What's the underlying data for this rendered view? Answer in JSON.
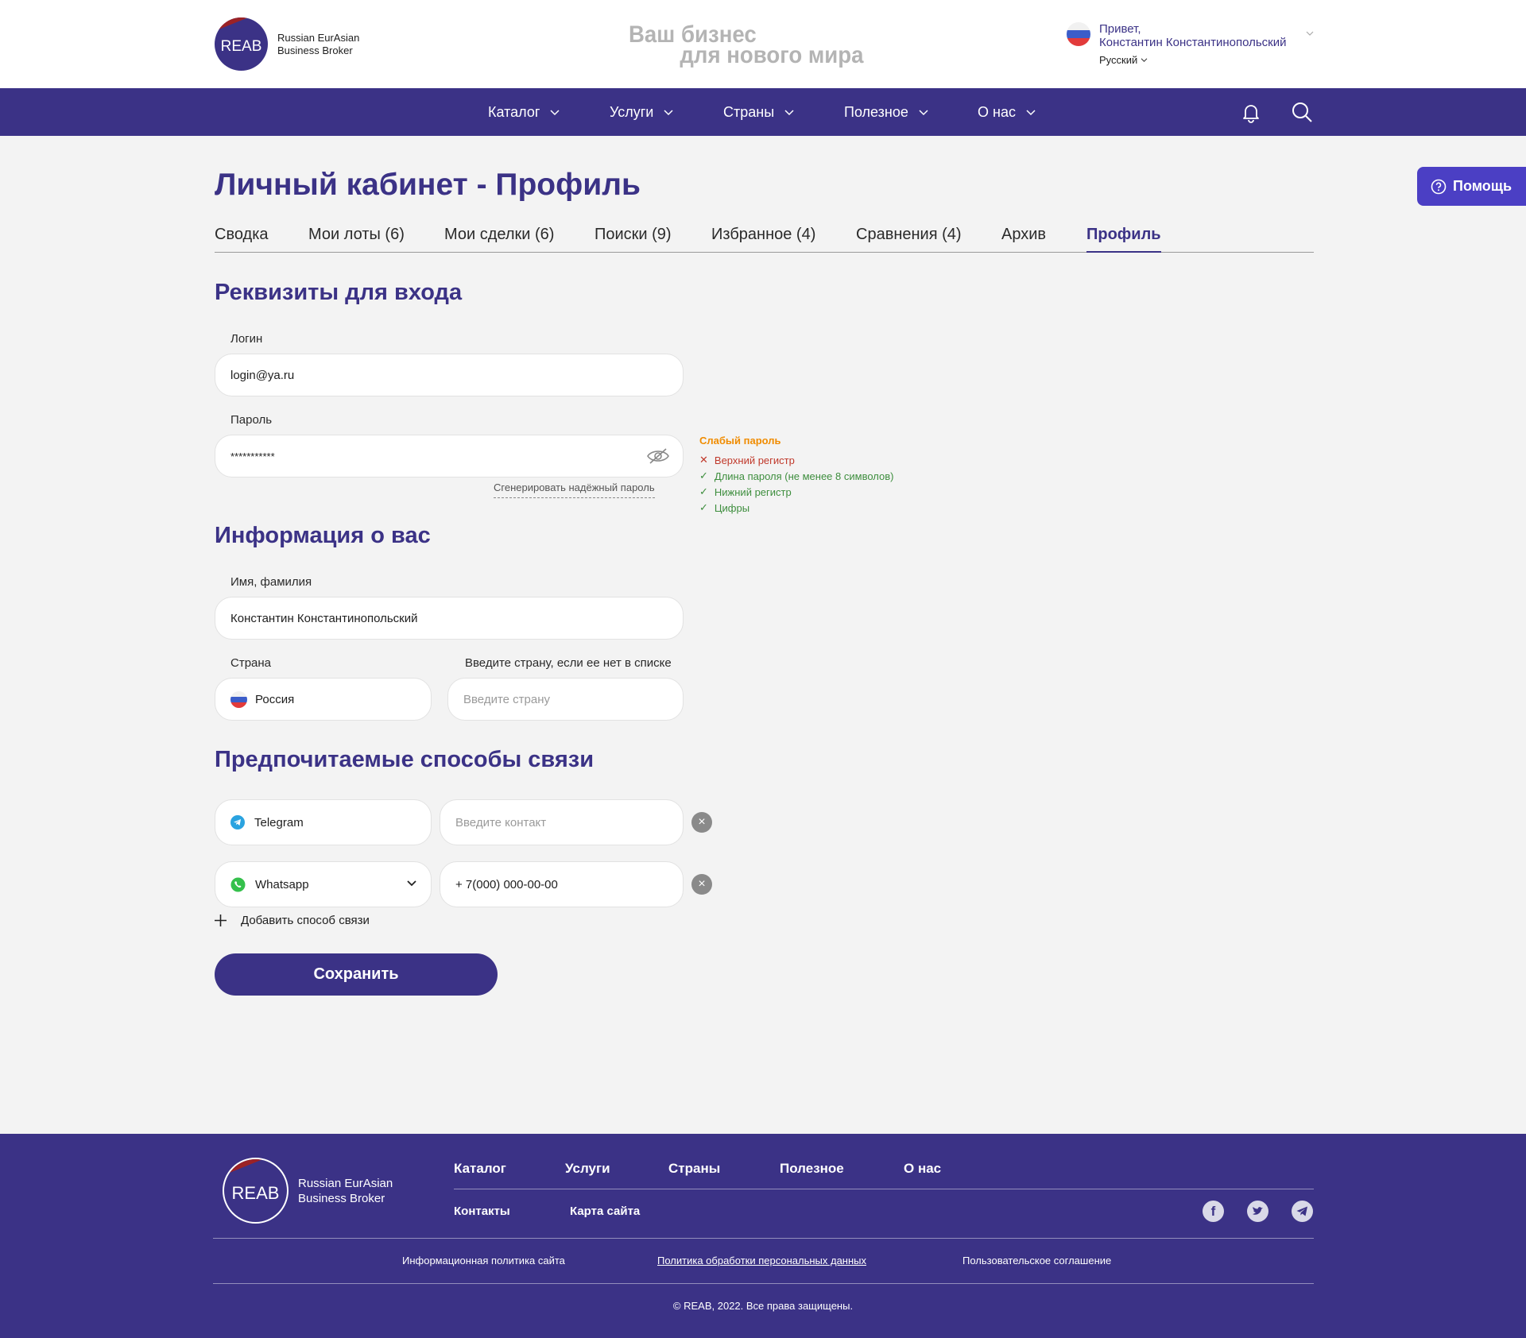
{
  "header": {
    "logo_text": "REAB",
    "brand_line1": "Russian EurAsian",
    "brand_line2": "Business Broker",
    "slogan_line1": "Ваш бизнес",
    "slogan_line2": "для нового мира",
    "greeting": "Привет,",
    "user_name": "Константин Константинопольский",
    "language": "Русский"
  },
  "nav": {
    "items": [
      {
        "label": "Каталог"
      },
      {
        "label": "Услуги"
      },
      {
        "label": "Страны"
      },
      {
        "label": "Полезное"
      },
      {
        "label": "О нас"
      }
    ]
  },
  "help_button": "Помощь",
  "page_title": "Личный кабинет - Профиль",
  "tabs": [
    {
      "label": "Сводка"
    },
    {
      "label": "Мои лоты (6)"
    },
    {
      "label": "Мои сделки (6)"
    },
    {
      "label": "Поиски (9)"
    },
    {
      "label": "Избранное (4)"
    },
    {
      "label": "Сравнения (4)"
    },
    {
      "label": "Архив"
    },
    {
      "label": "Профиль"
    }
  ],
  "login_section": {
    "title": "Реквизиты для входа",
    "login_label": "Логин",
    "login_value": "login@ya.ru",
    "password_label": "Пароль",
    "password_value": "***********",
    "generate_link": "Сгенерировать надёжный пароль",
    "strength_title": "Слабый пароль",
    "rules": [
      {
        "text": "Верхний регистр",
        "ok": false
      },
      {
        "text": "Длина пароля (не менее 8 символов)",
        "ok": true
      },
      {
        "text": "Нижний регистр",
        "ok": true
      },
      {
        "text": "Цифры",
        "ok": true
      }
    ]
  },
  "info_section": {
    "title": "Информация о вас",
    "name_label": "Имя, фамилия",
    "name_value": "Константин Константинопольский",
    "country_label": "Страна",
    "country_value": "Россия",
    "other_country_label": "Введите страну, если ее нет в списке",
    "other_country_placeholder": "Введите страну"
  },
  "contact_section": {
    "title": "Предпочитаемые способы связи",
    "rows": [
      {
        "method": "Telegram",
        "placeholder": "Введите контакт",
        "value": ""
      },
      {
        "method": "Whatsapp",
        "placeholder": "",
        "value": "+ 7(000) 000-00-00"
      }
    ],
    "add_label": "Добавить способ связи",
    "save_label": "Сохранить"
  },
  "footer": {
    "links": [
      "Каталог",
      "Услуги",
      "Страны",
      "Полезное",
      "О нас"
    ],
    "links2": [
      "Контакты",
      "Карта сайта"
    ],
    "legal": [
      "Информационная политика сайта",
      "Политика обработки персональных данных",
      "Пользовательское соглашение"
    ],
    "copyright": "© REAB, 2022. Все права защищены."
  },
  "colors": {
    "brand": "#3b3286",
    "accent_red": "#9b2226",
    "help_bg": "#4b3fc4",
    "weak": "#f08c00",
    "ok": "#3e8e3e",
    "bad": "#c0392b"
  }
}
